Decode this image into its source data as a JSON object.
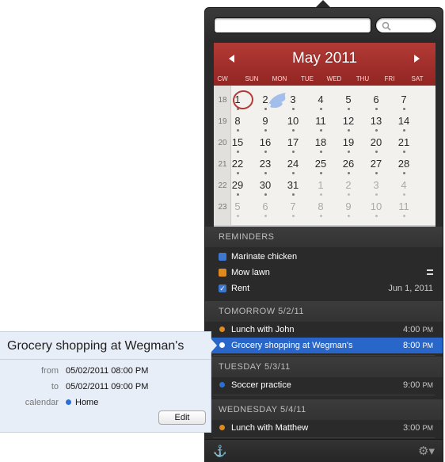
{
  "calendar": {
    "month_title": "May 2011",
    "weekday_labels": [
      "CW",
      "SUN",
      "MON",
      "TUE",
      "WED",
      "THU",
      "FRI",
      "SAT"
    ],
    "weeks": [
      {
        "cw": "18",
        "days": [
          "1",
          "2",
          "3",
          "4",
          "5",
          "6",
          "7"
        ]
      },
      {
        "cw": "19",
        "days": [
          "8",
          "9",
          "10",
          "11",
          "12",
          "13",
          "14"
        ]
      },
      {
        "cw": "20",
        "days": [
          "15",
          "16",
          "17",
          "18",
          "19",
          "20",
          "21"
        ]
      },
      {
        "cw": "21",
        "days": [
          "22",
          "23",
          "24",
          "25",
          "26",
          "27",
          "28"
        ]
      },
      {
        "cw": "22",
        "days": [
          "29",
          "30",
          "31",
          "1",
          "2",
          "3",
          "4"
        ]
      },
      {
        "cw": "23",
        "days": [
          "5",
          "6",
          "7",
          "8",
          "9",
          "10",
          "11"
        ]
      }
    ]
  },
  "reminders": {
    "header": "REMINDERS",
    "items": [
      {
        "label": "Marinate chicken",
        "color": "#3d77cf",
        "checked": false,
        "due": ""
      },
      {
        "label": "Mow lawn",
        "color": "#e08a1e",
        "checked": false,
        "due": ""
      },
      {
        "label": "Rent",
        "color": "#3d77cf",
        "checked": true,
        "due": "Jun 1, 2011"
      }
    ]
  },
  "agenda": [
    {
      "header": "TOMORROW 5/2/11",
      "events": [
        {
          "title": "Lunch with John",
          "time": "4:00",
          "ampm": "PM",
          "color": "#e08a1e"
        },
        {
          "title": "Grocery shopping at Wegman's",
          "time": "8:00",
          "ampm": "PM",
          "color": "#ffffff"
        }
      ]
    },
    {
      "header": "TUESDAY 5/3/11",
      "events": [
        {
          "title": "Soccer practice",
          "time": "9:00",
          "ampm": "PM",
          "color": "#2b6fd6"
        }
      ]
    },
    {
      "header": "WEDNESDAY 5/4/11",
      "events": [
        {
          "title": "Lunch with Matthew",
          "time": "3:00",
          "ampm": "PM",
          "color": "#e08a1e"
        }
      ]
    }
  ],
  "popover": {
    "title": "Grocery shopping at Wegman's",
    "from_label": "from",
    "from_value": "05/02/2011 08:00 PM",
    "to_label": "to",
    "to_value": "05/02/2011 09:00 PM",
    "calendar_label": "calendar",
    "calendar_value": "Home",
    "calendar_color": "#2b6fd6",
    "edit_label": "Edit"
  },
  "icons": {
    "search": "search-icon",
    "anchor": "anchor-icon",
    "gear": "gear-icon"
  }
}
